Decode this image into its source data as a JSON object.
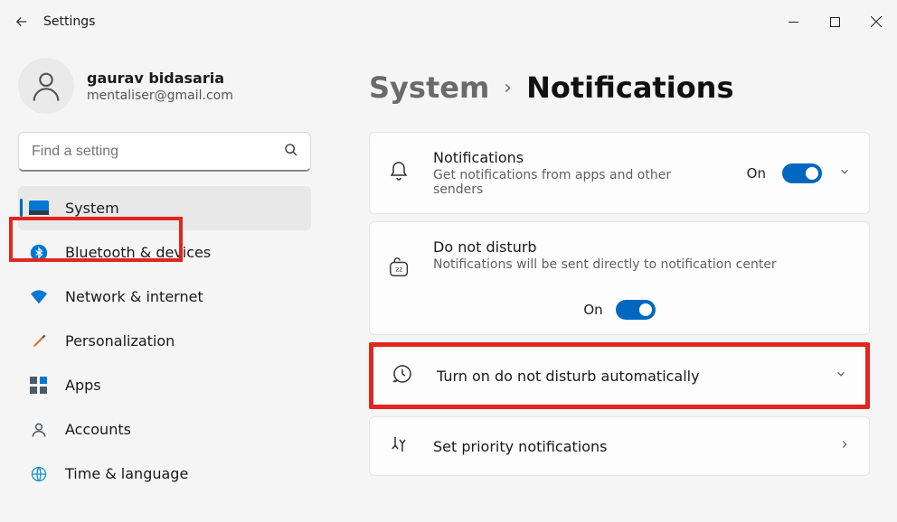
{
  "titlebar": {
    "title": "Settings"
  },
  "profile": {
    "name": "gaurav bidasaria",
    "email": "mentaliser@gmail.com"
  },
  "search": {
    "placeholder": "Find a setting"
  },
  "sidebar": {
    "items": [
      {
        "label": "System"
      },
      {
        "label": "Bluetooth & devices"
      },
      {
        "label": "Network & internet"
      },
      {
        "label": "Personalization"
      },
      {
        "label": "Apps"
      },
      {
        "label": "Accounts"
      },
      {
        "label": "Time & language"
      }
    ]
  },
  "breadcrumb": {
    "parent": "System",
    "sep": "›",
    "current": "Notifications"
  },
  "cards": {
    "notifications": {
      "title": "Notifications",
      "sub": "Get notifications from apps and other senders",
      "state_label": "On"
    },
    "dnd": {
      "title": "Do not disturb",
      "sub": "Notifications will be sent directly to notification center",
      "state_label": "On"
    },
    "auto": {
      "title": "Turn on do not disturb automatically"
    },
    "priority": {
      "title": "Set priority notifications"
    }
  }
}
